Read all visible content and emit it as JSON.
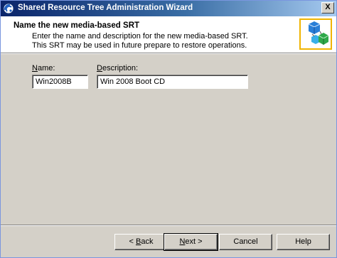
{
  "window": {
    "title": "Shared Resource Tree Administration Wizard",
    "close_glyph": "X"
  },
  "header": {
    "title": "Name the new media-based SRT",
    "desc_line1": "Enter the name and description for the new media-based SRT.",
    "desc_line2": "This SRT may be used in future prepare to restore operations."
  },
  "form": {
    "name_label_ul": "N",
    "name_label_rest": "ame:",
    "name_value": "Win2008B",
    "desc_label_ul": "D",
    "desc_label_rest": "escription:",
    "desc_value": "Win 2008 Boot CD"
  },
  "buttons": {
    "back_pre": "< ",
    "back_ul": "B",
    "back_rest": "ack",
    "next_ul": "N",
    "next_rest": "ext >",
    "cancel": "Cancel",
    "help": "Help"
  },
  "colors": {
    "title_start": "#0a246a",
    "title_end": "#a6caf0",
    "face": "#d4d0c8",
    "graphic_border": "#f0b400"
  }
}
